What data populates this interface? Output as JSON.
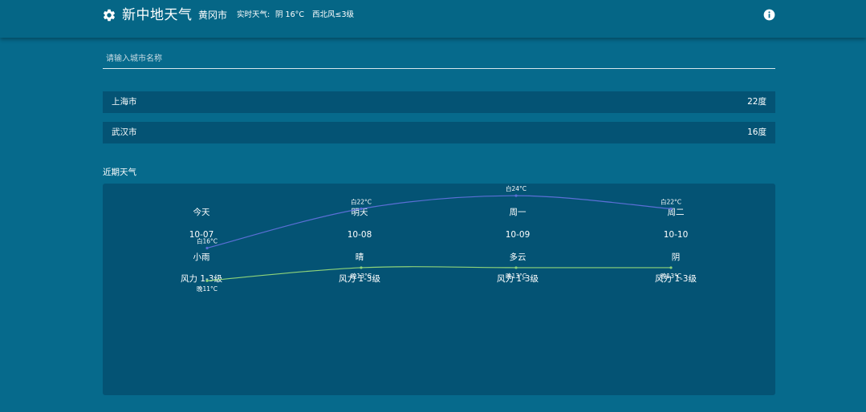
{
  "header": {
    "title": "新中地天气",
    "city": "黄冈市",
    "realtime_label": "实时天气:",
    "realtime_value": "阴 16°C",
    "wind": "西北风≤3级"
  },
  "search": {
    "placeholder": "请输入城市名称",
    "value": ""
  },
  "saved_cities": [
    {
      "name": "上海市",
      "temp": "22度"
    },
    {
      "name": "武汉市",
      "temp": "16度"
    }
  ],
  "forecast": {
    "section_title": "近期天气",
    "days": [
      {
        "name": "今天",
        "date": "10-07",
        "condition": "小雨",
        "wind": "风力 1-3级",
        "high_label": "白16°C",
        "low_label": "晚11°C"
      },
      {
        "name": "明天",
        "date": "10-08",
        "condition": "晴",
        "wind": "风力 1-3级",
        "high_label": "白22°C",
        "low_label": "晚13°C"
      },
      {
        "name": "周一",
        "date": "10-09",
        "condition": "多云",
        "wind": "风力 1-3级",
        "high_label": "白24°C",
        "low_label": "晚13°C"
      },
      {
        "name": "周二",
        "date": "10-10",
        "condition": "阴",
        "wind": "风力 1-3级",
        "high_label": "白22°C",
        "low_label": "晚13°C"
      }
    ]
  },
  "chart_data": {
    "type": "line",
    "x": [
      "今天",
      "明天",
      "周一",
      "周二"
    ],
    "series": [
      {
        "values": [
          16,
          22,
          24,
          22
        ],
        "color": "#5b6fd6"
      },
      {
        "values": [
          11,
          13,
          13,
          13
        ],
        "color": "#8fd47a"
      }
    ]
  },
  "colors": {
    "background": "#066a8c",
    "header": "#056686",
    "card": "#045374",
    "high_line": "#5b6fd6",
    "low_line": "#8fd47a"
  },
  "icons": {
    "logo": "gear-icon",
    "info": "info-icon"
  }
}
